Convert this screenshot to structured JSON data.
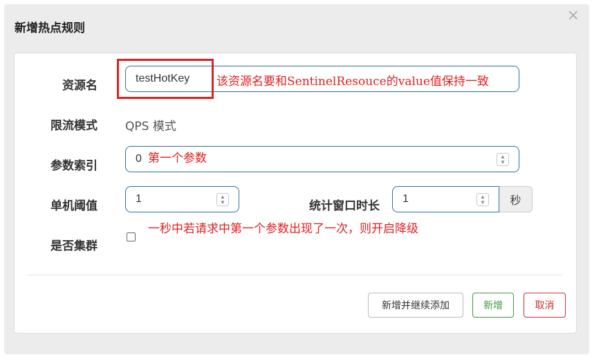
{
  "dialog": {
    "title": "新增热点规则",
    "close_icon": "×"
  },
  "form": {
    "resource": {
      "label": "资源名",
      "value": "testHotKey",
      "annotation": "该资源名要和SentinelResouce的value值保持一致"
    },
    "mode": {
      "label": "限流模式",
      "value": "QPS 模式"
    },
    "param_index": {
      "label": "参数索引",
      "value": "0",
      "annotation": "第一个参数"
    },
    "threshold": {
      "label": "单机阈值",
      "value": "1"
    },
    "window": {
      "label": "统计窗口时长",
      "value": "1",
      "unit": "秒"
    },
    "cluster": {
      "label": "是否集群",
      "checked": false,
      "annotation": "一秒中若请求中第一个参数出现了一次，则开启降级"
    }
  },
  "footer": {
    "add_continue_label": "新增并继续添加",
    "add_label": "新增",
    "cancel_label": "取消"
  },
  "colors": {
    "annotation": "#e02020",
    "input_border": "#2e6da4",
    "add_button": "#3c9a3c",
    "cancel_button": "#c9302c"
  }
}
